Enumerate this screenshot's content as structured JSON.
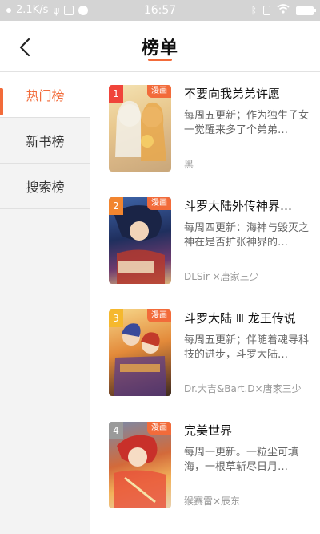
{
  "status_bar": {
    "network_speed": "2.1K/s",
    "time": "16:57"
  },
  "header": {
    "title": "榜单"
  },
  "sidebar": {
    "items": [
      {
        "label": "热门榜",
        "active": true
      },
      {
        "label": "新书榜",
        "active": false
      },
      {
        "label": "搜索榜",
        "active": false
      }
    ]
  },
  "list": {
    "items": [
      {
        "rank": "1",
        "tag": "漫画",
        "title": "不要向我弟弟许愿",
        "desc": "每周五更新；作为独生子女一觉醒来多了个弟弟…",
        "author": "黑一",
        "rank_color": "#f0443a"
      },
      {
        "rank": "2",
        "tag": "漫画",
        "title": "斗罗大陆外传神界…",
        "desc": "每周四更新：海神与毁灭之神在是否扩张神界的…",
        "author": "DLSir ×唐家三少",
        "rank_color": "#f2852f"
      },
      {
        "rank": "3",
        "tag": "漫画",
        "title": "斗罗大陆 Ⅲ 龙王传说",
        "desc": "每周五更新；伴随着魂导科技的进步，斗罗大陆…",
        "author": "Dr.大吉&Bart.D×唐家三少",
        "rank_color": "#f5b82e"
      },
      {
        "rank": "4",
        "tag": "漫画",
        "title": "完美世界",
        "desc": "每周一更新。一粒尘可填海，一根草斩尽日月…",
        "author": "猴赛雷×辰东",
        "rank_color": "#9a9a9a"
      }
    ]
  },
  "colors": {
    "accent": "#f26b3a"
  }
}
